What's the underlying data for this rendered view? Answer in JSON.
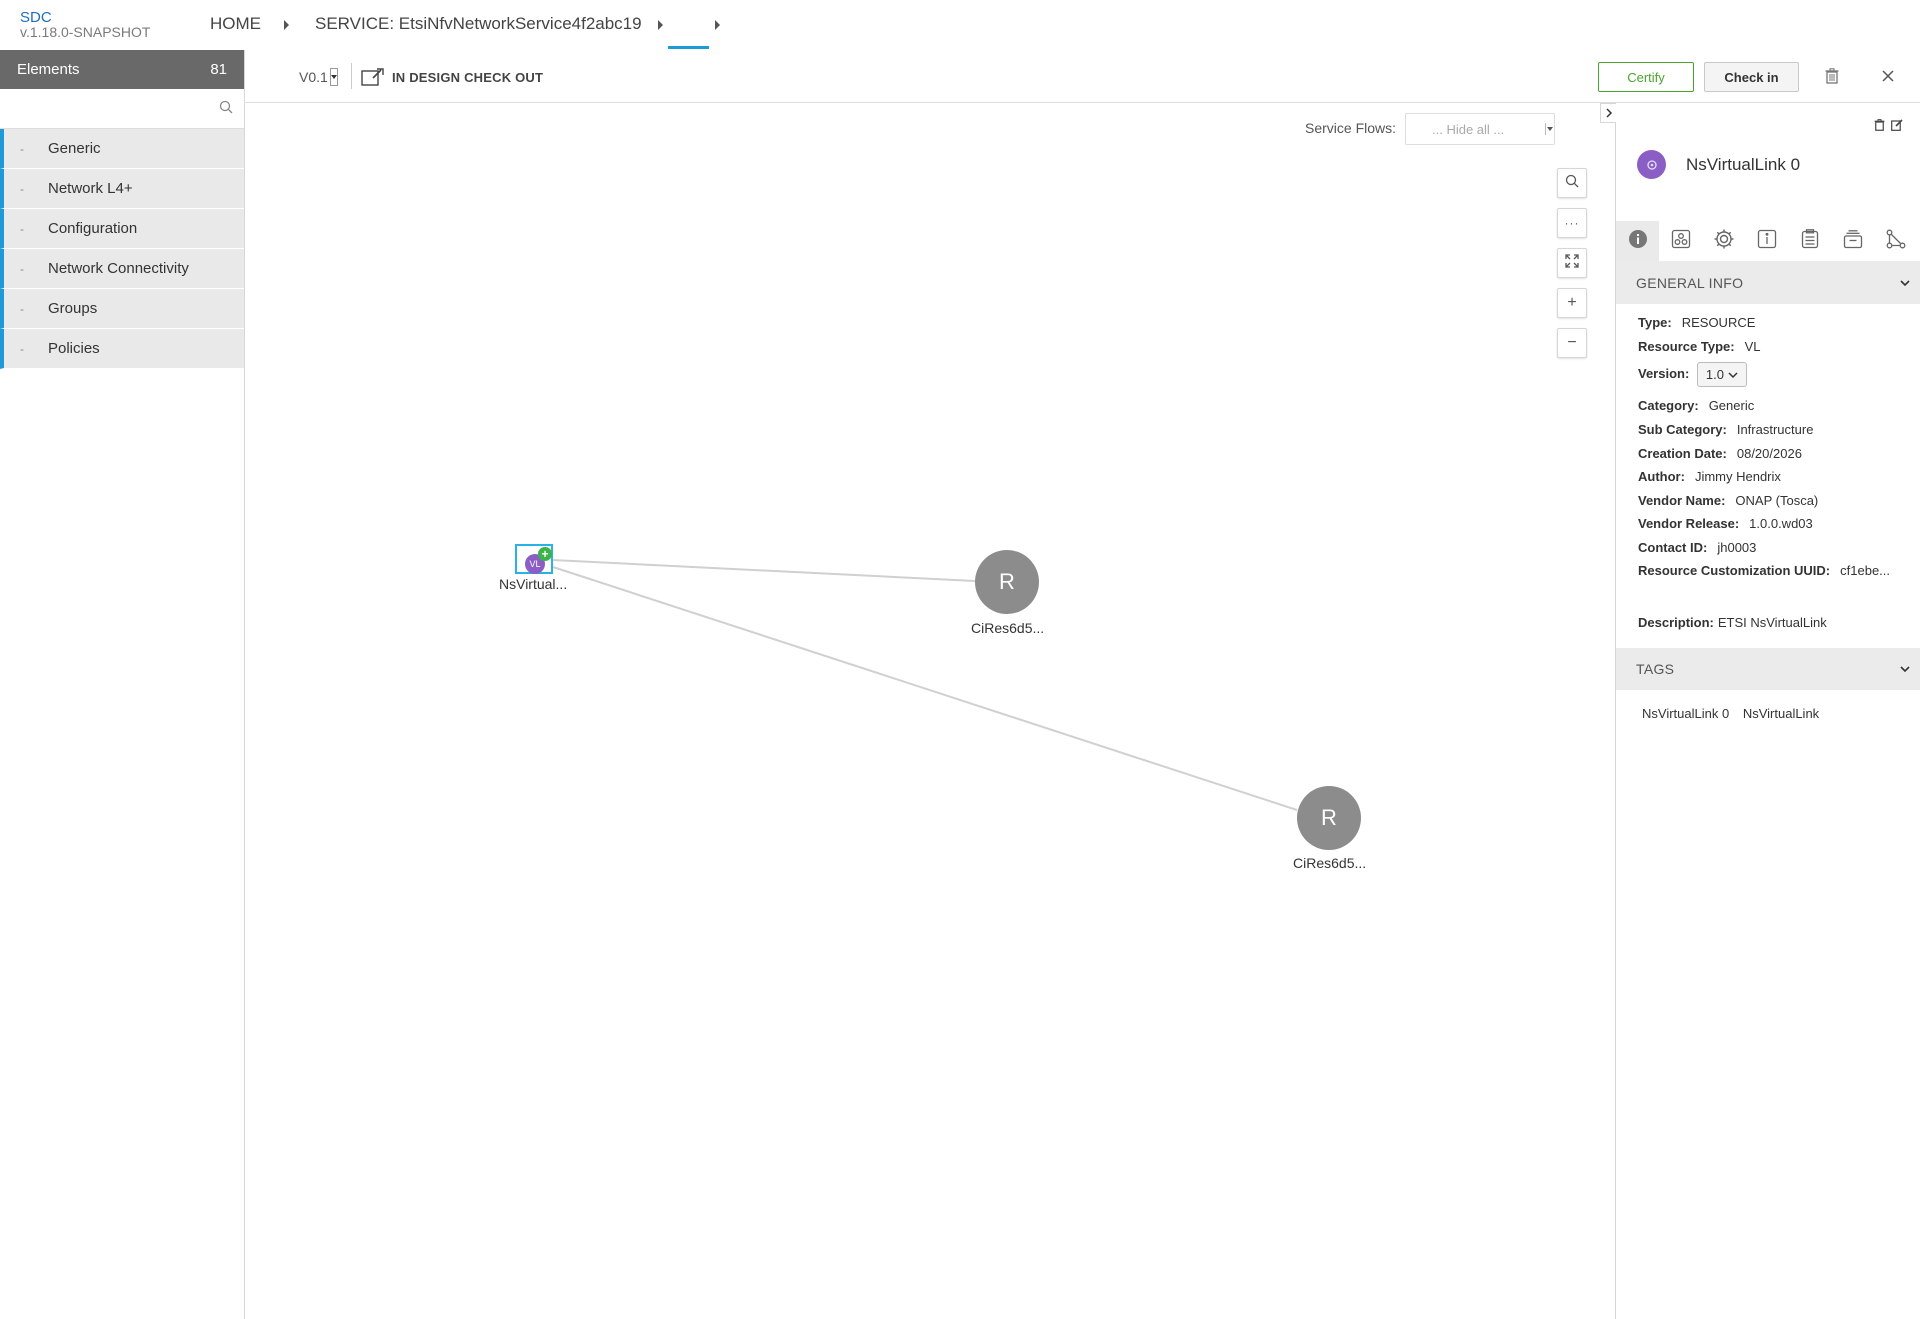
{
  "app": {
    "name": "SDC",
    "version": "v.1.18.0-SNAPSHOT"
  },
  "breadcrumb": {
    "home": "HOME",
    "service": "SERVICE: EtsiNfvNetworkService4f2abc19"
  },
  "palette": {
    "title": "Elements",
    "count": "81",
    "search_placeholder": "",
    "items": [
      {
        "label": "Generic"
      },
      {
        "label": "Network L4+"
      },
      {
        "label": "Configuration"
      },
      {
        "label": "Network Connectivity"
      },
      {
        "label": "Groups"
      },
      {
        "label": "Policies"
      }
    ]
  },
  "toolbar": {
    "version": "V0.1",
    "state": "IN DESIGN CHECK OUT",
    "certify": "Certify",
    "checkin": "Check in"
  },
  "canvas": {
    "service_flows_label": "Service Flows:",
    "service_flows_value": "... Hide all ...",
    "zoom_controls": [
      "search-icon",
      "more-icon",
      "fit-icon",
      "zoom-in-icon",
      "zoom-out-icon"
    ],
    "nodes": {
      "vl": {
        "label": "NsVirtual...",
        "icon_text": "VL"
      },
      "r1": {
        "label": "CiRes6d5...",
        "letter": "R"
      },
      "r2": {
        "label": "CiRes6d5...",
        "letter": "R"
      }
    }
  },
  "details": {
    "title": "NsVirtualLink 0",
    "general_info_title": "GENERAL INFO",
    "tags_title": "TAGS",
    "labels": {
      "type": "Type:",
      "resource_type": "Resource Type:",
      "version": "Version:",
      "category": "Category:",
      "sub_category": "Sub Category:",
      "creation_date": "Creation Date:",
      "author": "Author:",
      "vendor_name": "Vendor Name:",
      "vendor_release": "Vendor Release:",
      "contact_id": "Contact ID:",
      "customization_uuid": "Resource Customization UUID:",
      "description": "Description:"
    },
    "values": {
      "type": "RESOURCE",
      "resource_type": "VL",
      "version": "1.0",
      "category": "Generic",
      "sub_category": "Infrastructure",
      "creation_date": "08/20/2026",
      "author": "Jimmy Hendrix",
      "vendor_name": "ONAP (Tosca)",
      "vendor_release": "1.0.0.wd03",
      "contact_id": "jh0003",
      "customization_uuid": "cf1ebe...",
      "description": "ETSI NsVirtualLink"
    },
    "tags": [
      "NsVirtualLink 0",
      "NsVirtualLink"
    ]
  },
  "colors": {
    "accent": "#1e9ad6",
    "certify_green": "#4aa32f",
    "vl_purple": "#8b5ec6",
    "resource_gray": "#8c8c8c",
    "palette_header": "#696969"
  }
}
